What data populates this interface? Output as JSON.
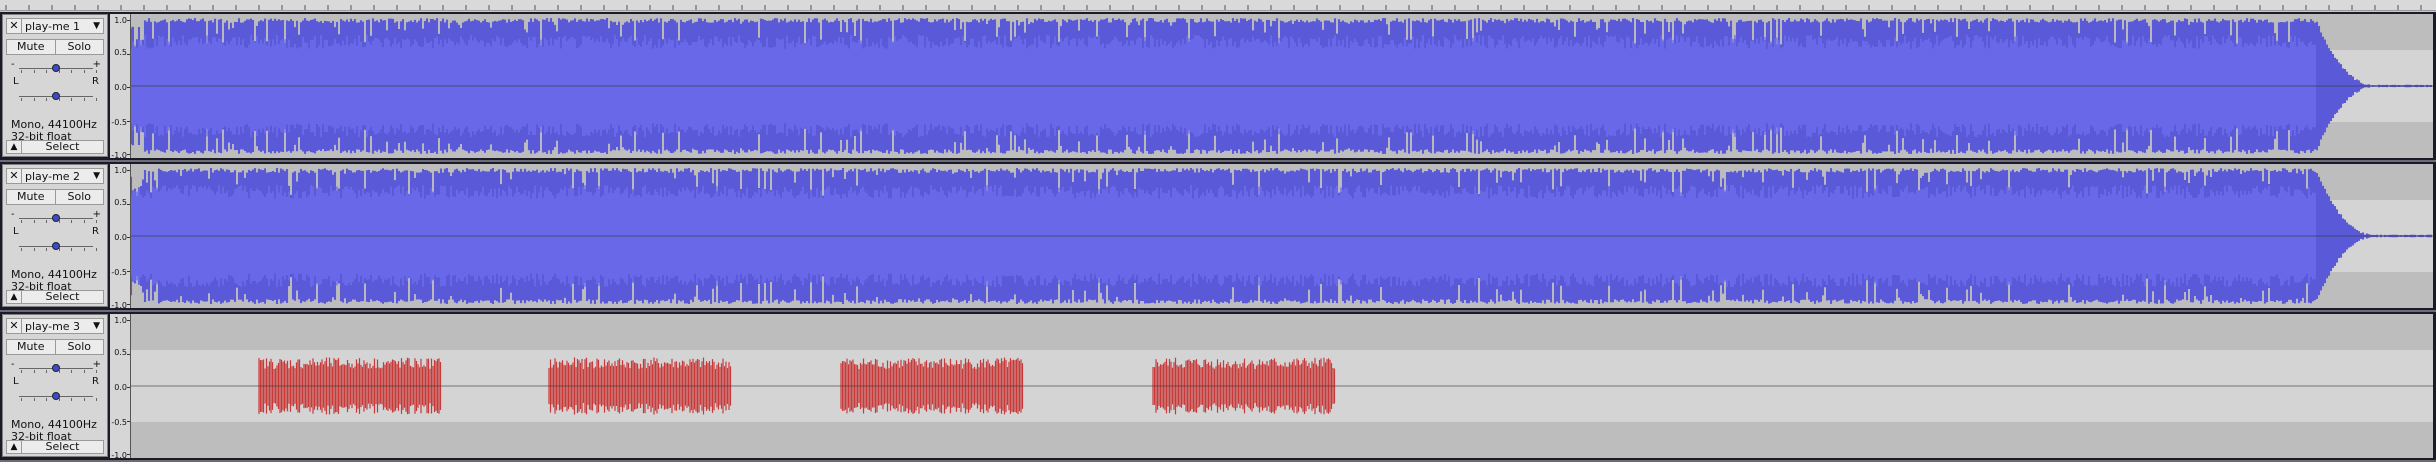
{
  "scale_labels": [
    "1.0",
    "0.5",
    "0.0",
    "-0.5",
    "-1.0"
  ],
  "tracks": [
    {
      "name": "play-me 1",
      "mute_label": "Mute",
      "solo_label": "Solo",
      "gain_minus": "-",
      "gain_plus": "+",
      "pan_left": "L",
      "pan_right": "R",
      "gain_level": 0.5,
      "pan_level": 0.5,
      "format_line1": "Mono, 44100Hz",
      "format_line2": "32-bit float",
      "select_label": "Select",
      "waveform": "dense-full",
      "waveform_color": "#5a5ad8",
      "rms_color": "#6e6ef0"
    },
    {
      "name": "play-me 2",
      "mute_label": "Mute",
      "solo_label": "Solo",
      "gain_minus": "-",
      "gain_plus": "+",
      "pan_left": "L",
      "pan_right": "R",
      "gain_level": 0.5,
      "pan_level": 0.5,
      "format_line1": "Mono, 44100Hz",
      "format_line2": "32-bit float",
      "select_label": "Select",
      "waveform": "dense-full",
      "waveform_color": "#5a5ad8",
      "rms_color": "#6e6ef0"
    },
    {
      "name": "play-me 3",
      "mute_label": "Mute",
      "solo_label": "Solo",
      "gain_minus": "-",
      "gain_plus": "+",
      "pan_left": "L",
      "pan_right": "R",
      "gain_level": 0.5,
      "pan_level": 0.5,
      "format_line1": "Mono, 44100Hz",
      "format_line2": "32-bit float",
      "select_label": "Select",
      "waveform": "bursts",
      "waveform_color": "#c83a3a",
      "rms_color": "#e05a5a"
    }
  ],
  "colors": {
    "clip_bg": "#bdbdbd",
    "clip_band": "#d4d4d4",
    "track_bg": "#1b1b28"
  }
}
